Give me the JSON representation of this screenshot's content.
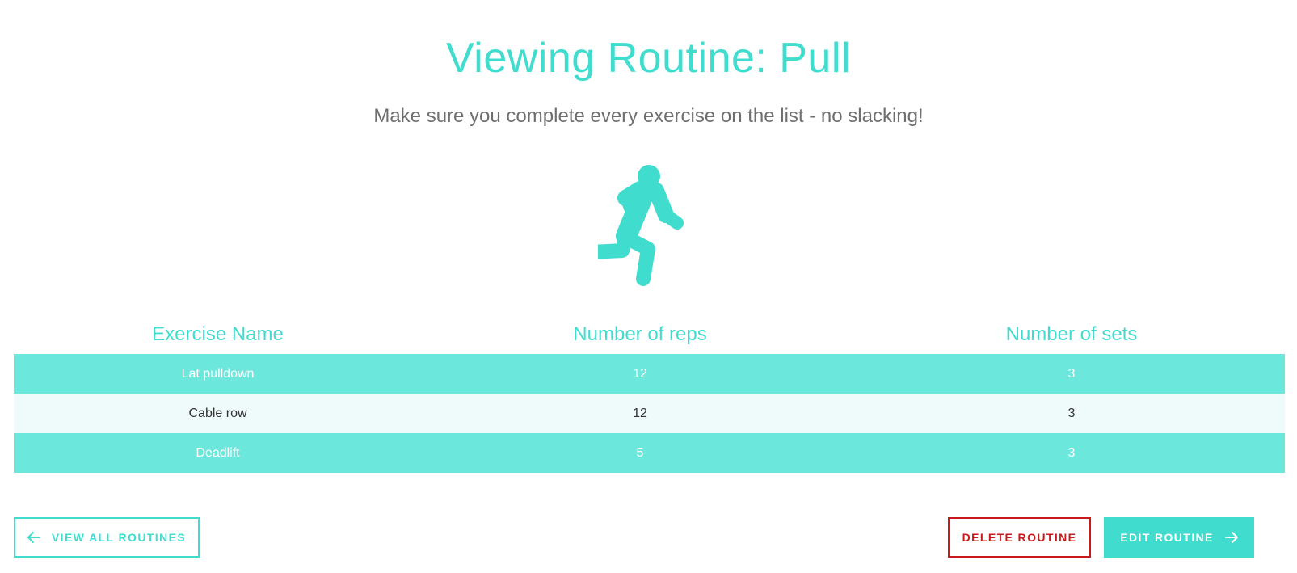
{
  "header": {
    "title": "Viewing Routine: Pull",
    "subtitle": "Make sure you complete every exercise on the list - no slacking!"
  },
  "hero": {
    "icon": "running-person-icon"
  },
  "table": {
    "columns": [
      "Exercise Name",
      "Number of reps",
      "Number of sets"
    ],
    "rows": [
      {
        "name": "Lat pulldown",
        "reps": "12",
        "sets": "3"
      },
      {
        "name": "Cable row",
        "reps": "12",
        "sets": "3"
      },
      {
        "name": "Deadlift",
        "reps": "5",
        "sets": "3"
      }
    ]
  },
  "actions": {
    "back_label": "VIEW ALL ROUTINES",
    "delete_label": "DELETE ROUTINE",
    "edit_label": "EDIT ROUTINE"
  },
  "colors": {
    "accent": "#40ddcf",
    "row_teal": "#6ce7dc",
    "row_light": "#eefbfa",
    "danger": "#c81a1a"
  }
}
